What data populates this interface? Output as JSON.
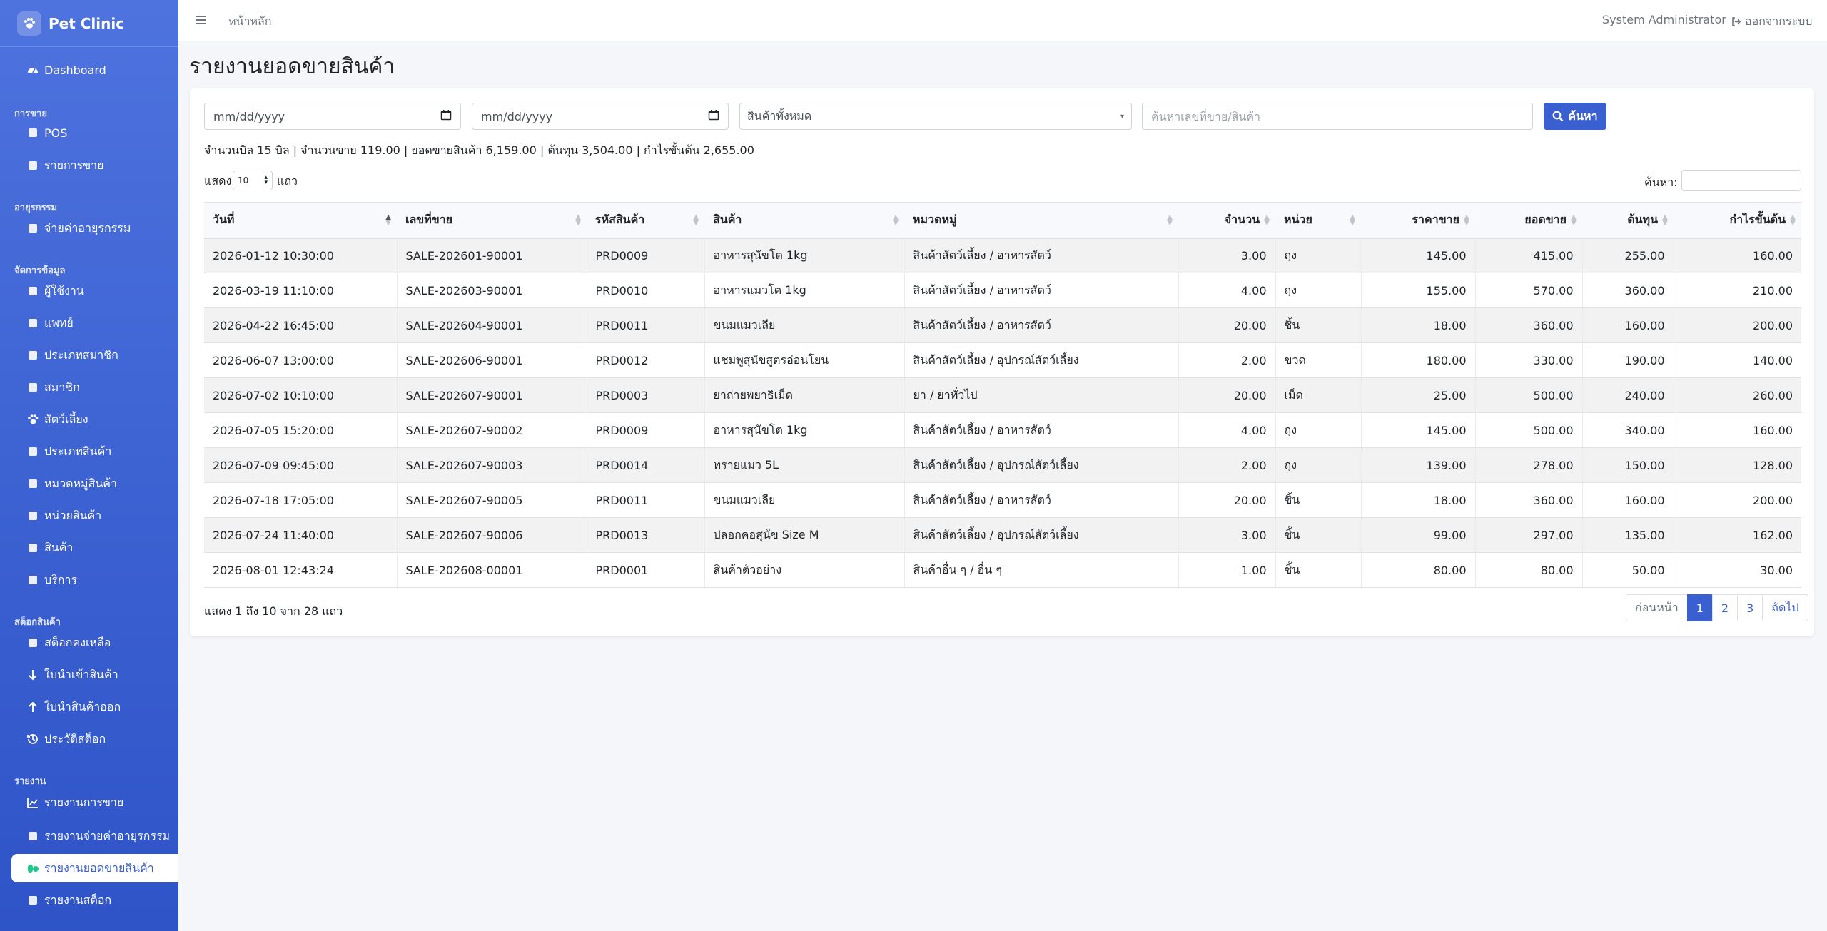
{
  "brand": {
    "name": "Pet Clinic"
  },
  "sidebar": {
    "items": [
      {
        "label": "Dashboard",
        "icon": "gauge-icon"
      },
      {
        "section": "การขาย"
      },
      {
        "label": "POS",
        "icon": "cash-register-icon"
      },
      {
        "label": "รายการขาย",
        "icon": "receipt-icon"
      },
      {
        "section": "อายุรกรรม"
      },
      {
        "label": "จ่ายค่าอายุรกรรม",
        "icon": "invoice-icon"
      },
      {
        "section": "จัดการข้อมูล"
      },
      {
        "label": "ผู้ใช้งาน",
        "icon": "users-icon"
      },
      {
        "label": "แพทย์",
        "icon": "doctor-icon"
      },
      {
        "label": "ประเภทสมาชิก",
        "icon": "id-card-icon"
      },
      {
        "label": "สมาชิก",
        "icon": "address-book-icon"
      },
      {
        "label": "สัตว์เลี้ยง",
        "icon": "paw-icon"
      },
      {
        "label": "ประเภทสินค้า",
        "icon": "tags-icon"
      },
      {
        "label": "หมวดหมู่สินค้า",
        "icon": "layers-icon"
      },
      {
        "label": "หน่วยสินค้า",
        "icon": "ruler-icon"
      },
      {
        "label": "สินค้า",
        "icon": "box-icon"
      },
      {
        "label": "บริการ",
        "icon": "stethoscope-icon"
      },
      {
        "section": "สต็อกสินค้า"
      },
      {
        "label": "สต็อกคงเหลือ",
        "icon": "warehouse-icon"
      },
      {
        "label": "ใบนำเข้าสินค้า",
        "icon": "arrow-down-icon"
      },
      {
        "label": "ใบนำสินค้าออก",
        "icon": "arrow-up-icon"
      },
      {
        "label": "ประวัติสต็อก",
        "icon": "history-icon"
      },
      {
        "section": "รายงาน"
      },
      {
        "label": "รายงานการขาย",
        "icon": "chart-line-icon"
      },
      {
        "label": "รายงานจ่ายค่าอายุรกรรม",
        "icon": "hand-money-icon"
      },
      {
        "label": "รายงานยอดขายสินค้า",
        "icon": "pills-icon",
        "active": true
      },
      {
        "label": "รายงานสต็อก",
        "icon": "clipboard-icon"
      }
    ]
  },
  "topbar": {
    "home": "หน้าหลัก",
    "user": "System Administrator",
    "logout": "ออกจากระบบ"
  },
  "page": {
    "title": "รายงานยอดขายสินค้า"
  },
  "filters": {
    "date_from": "mm/dd/yyyy",
    "date_to": "mm/dd/yyyy",
    "product_select": "สินค้าทั้งหมด",
    "search_placeholder": "ค้นหาเลขที่ขาย/สินค้า",
    "search_button": "ค้นหา"
  },
  "summary": "จำนวนบิล 15 บิล | จำนวนขาย 119.00 | ยอดขายสินค้า 6,159.00 | ต้นทุน 3,504.00 | กำไรขั้นต้น 2,655.00",
  "length": {
    "prefix": "แสดง",
    "value": "10",
    "suffix": "แถว"
  },
  "table_filter_label": "ค้นหา:",
  "table": {
    "columns": [
      "วันที่",
      "เลขที่ขาย",
      "รหัสสินค้า",
      "สินค้า",
      "หมวดหมู่",
      "จำนวน",
      "หน่วย",
      "ราคาขาย",
      "ยอดขาย",
      "ต้นทุน",
      "กำไรขั้นต้น"
    ],
    "rows": [
      [
        "2026-01-12 10:30:00",
        "SALE-202601-90001",
        "PRD0009",
        "อาหารสุนัขโต 1kg",
        "สินค้าสัตว์เลี้ยง / อาหารสัตว์",
        "3.00",
        "ถุง",
        "145.00",
        "415.00",
        "255.00",
        "160.00"
      ],
      [
        "2026-03-19 11:10:00",
        "SALE-202603-90001",
        "PRD0010",
        "อาหารแมวโต 1kg",
        "สินค้าสัตว์เลี้ยง / อาหารสัตว์",
        "4.00",
        "ถุง",
        "155.00",
        "570.00",
        "360.00",
        "210.00"
      ],
      [
        "2026-04-22 16:45:00",
        "SALE-202604-90001",
        "PRD0011",
        "ขนมแมวเลีย",
        "สินค้าสัตว์เลี้ยง / อาหารสัตว์",
        "20.00",
        "ชิ้น",
        "18.00",
        "360.00",
        "160.00",
        "200.00"
      ],
      [
        "2026-06-07 13:00:00",
        "SALE-202606-90001",
        "PRD0012",
        "แชมพูสุนัขสูตรอ่อนโยน",
        "สินค้าสัตว์เลี้ยง / อุปกรณ์สัตว์เลี้ยง",
        "2.00",
        "ขวด",
        "180.00",
        "330.00",
        "190.00",
        "140.00"
      ],
      [
        "2026-07-02 10:10:00",
        "SALE-202607-90001",
        "PRD0003",
        "ยาถ่ายพยาธิเม็ด",
        "ยา / ยาทั่วไป",
        "20.00",
        "เม็ด",
        "25.00",
        "500.00",
        "240.00",
        "260.00"
      ],
      [
        "2026-07-05 15:20:00",
        "SALE-202607-90002",
        "PRD0009",
        "อาหารสุนัขโต 1kg",
        "สินค้าสัตว์เลี้ยง / อาหารสัตว์",
        "4.00",
        "ถุง",
        "145.00",
        "500.00",
        "340.00",
        "160.00"
      ],
      [
        "2026-07-09 09:45:00",
        "SALE-202607-90003",
        "PRD0014",
        "ทรายแมว 5L",
        "สินค้าสัตว์เลี้ยง / อุปกรณ์สัตว์เลี้ยง",
        "2.00",
        "ถุง",
        "139.00",
        "278.00",
        "150.00",
        "128.00"
      ],
      [
        "2026-07-18 17:05:00",
        "SALE-202607-90005",
        "PRD0011",
        "ขนมแมวเลีย",
        "สินค้าสัตว์เลี้ยง / อาหารสัตว์",
        "20.00",
        "ชิ้น",
        "18.00",
        "360.00",
        "160.00",
        "200.00"
      ],
      [
        "2026-07-24 11:40:00",
        "SALE-202607-90006",
        "PRD0013",
        "ปลอกคอสุนัข Size M",
        "สินค้าสัตว์เลี้ยง / อุปกรณ์สัตว์เลี้ยง",
        "3.00",
        "ชิ้น",
        "99.00",
        "297.00",
        "135.00",
        "162.00"
      ],
      [
        "2026-08-01 12:43:24",
        "SALE-202608-00001",
        "PRD0001",
        "สินค้าตัวอย่าง",
        "สินค้าอื่น ๆ / อื่น ๆ",
        "1.00",
        "ชิ้น",
        "80.00",
        "80.00",
        "50.00",
        "30.00"
      ]
    ]
  },
  "info": "แสดง 1 ถึง 10 จาก 28 แถว",
  "pagination": {
    "prev": "ก่อนหน้า",
    "pages": [
      "1",
      "2",
      "3"
    ],
    "active": "1",
    "next": "ถัดไป"
  }
}
